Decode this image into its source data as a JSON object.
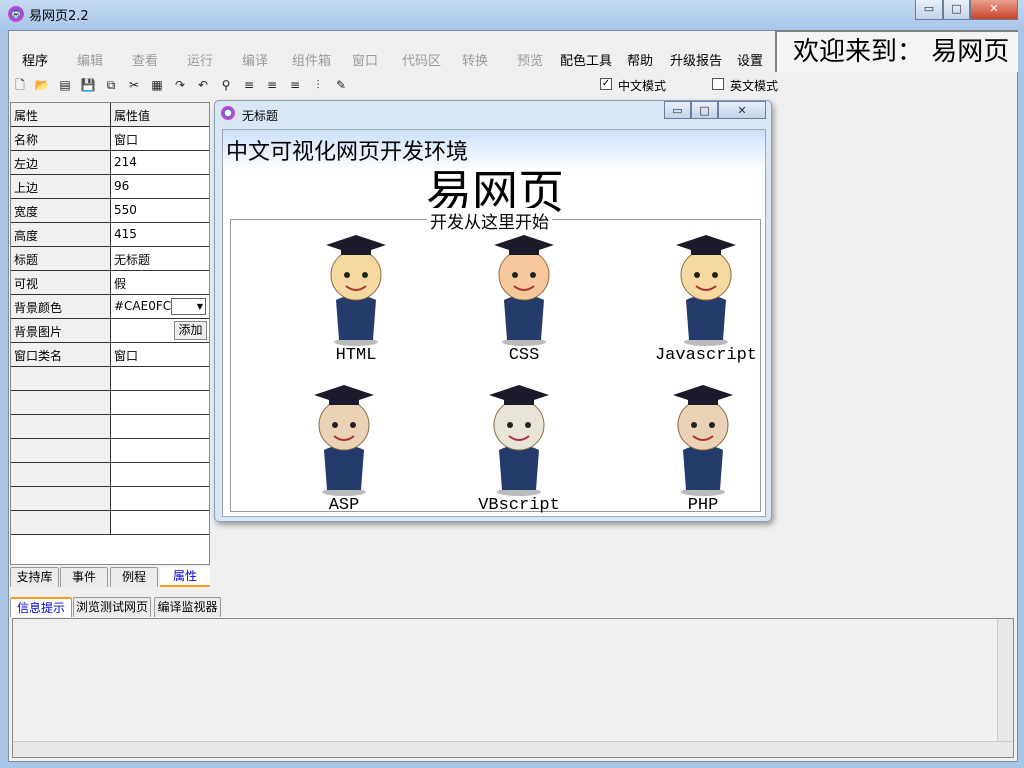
{
  "window": {
    "title": "易网页2.2",
    "icon": "app-logo-icon",
    "min": "▭",
    "max": "□",
    "close": "✕"
  },
  "menu": [
    {
      "label": "程序",
      "enabled": true
    },
    {
      "label": "编辑",
      "enabled": false
    },
    {
      "label": "查看",
      "enabled": false
    },
    {
      "label": "运行",
      "enabled": false
    },
    {
      "label": "编译",
      "enabled": false
    },
    {
      "label": "组件箱",
      "enabled": false
    },
    {
      "label": "窗口",
      "enabled": false
    },
    {
      "label": "代码区",
      "enabled": false
    },
    {
      "label": "转换",
      "enabled": false
    },
    {
      "label": "预览",
      "enabled": false
    },
    {
      "label": "配色工具",
      "enabled": true
    },
    {
      "label": "帮助",
      "enabled": true
    },
    {
      "label": "升级报告",
      "enabled": true
    },
    {
      "label": "设置",
      "enabled": true
    }
  ],
  "welcome": "欢迎来到：  易网页",
  "toolbar": {
    "icons": [
      "new-file-icon",
      "open-folder-icon",
      "properties-icon",
      "save-icon",
      "copy-icon",
      "cut-icon",
      "table-icon",
      "redo-icon",
      "undo-icon",
      "find-icon",
      "align-left-icon",
      "align-center-icon",
      "align-right-icon",
      "distribute-icon",
      "edit-icon"
    ],
    "glyphs": [
      "🗋",
      "📂",
      "▤",
      "💾",
      "⧉",
      "✂",
      "▦",
      "↷",
      "↶",
      "⚲",
      "≡",
      "≡",
      "≡",
      "⫶",
      "✎"
    ]
  },
  "modes": {
    "chinese": {
      "label": "中文模式",
      "checked": true
    },
    "english": {
      "label": "英文模式",
      "checked": false
    }
  },
  "properties": {
    "header": [
      "属性",
      "属性值"
    ],
    "rows": [
      [
        "名称",
        "窗口"
      ],
      [
        "左边",
        "214"
      ],
      [
        "上边",
        "96"
      ],
      [
        "宽度",
        "550"
      ],
      [
        "高度",
        "415"
      ],
      [
        "标题",
        "无标题"
      ],
      [
        "可视",
        "假"
      ],
      [
        "背景颜色",
        "#CAE0FC"
      ],
      [
        "背景图片",
        ""
      ],
      [
        "窗口类名",
        "窗口"
      ]
    ],
    "add_button": "添加"
  },
  "left_tabs": [
    "支持库",
    "事件",
    "例程",
    "属性"
  ],
  "form": {
    "title": "无标题",
    "heading": "中文可视化网页开发环境",
    "brand": "易网页",
    "legend": "开发从这里开始",
    "items": [
      "HTML",
      "CSS",
      "Javascript",
      "ASP",
      "VBscript",
      "PHP"
    ]
  },
  "bottom_tabs": [
    "信息提示",
    "浏览测试网页",
    "编译监视器"
  ],
  "colors": {
    "form_bg": "#CAE0FC",
    "active_tab": "#0000e0",
    "tab_underline": "#f0a020"
  }
}
